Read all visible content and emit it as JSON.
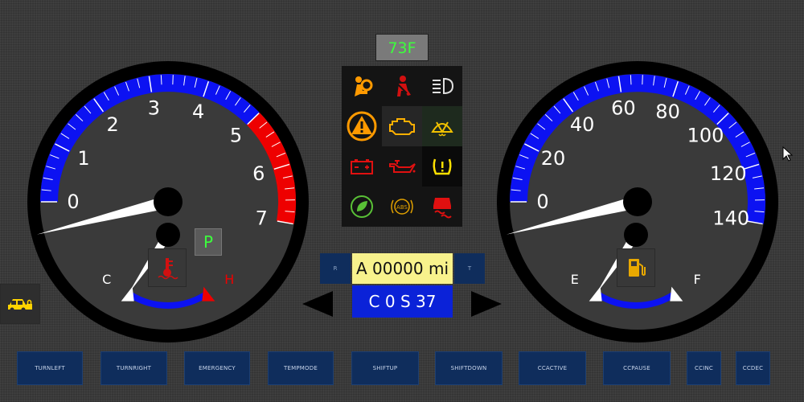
{
  "dashboard": {
    "outside_temp": "73F",
    "gear": "P",
    "odometer": "A 00000 mi",
    "cruise": "C 0  S 37",
    "odo_left_button": "R",
    "odo_right_button": "T"
  },
  "tachometer": {
    "labels": [
      "0",
      "1",
      "2",
      "3",
      "4",
      "5",
      "6",
      "7"
    ],
    "reading": 0,
    "colors": {
      "normal": "#0c12f2",
      "redline": "#ee0000"
    }
  },
  "speedometer": {
    "labels": [
      "0",
      "20",
      "40",
      "60",
      "80",
      "100",
      "120",
      "140"
    ],
    "reading": 0,
    "colors": {
      "band": "#0c12f2"
    }
  },
  "temp_gauge": {
    "cold_label": "C",
    "hot_label": "H",
    "icon": "coolant-temp-icon"
  },
  "fuel_gauge": {
    "empty_label": "E",
    "full_label": "F",
    "icon": "fuel-pump-icon"
  },
  "warning_lights": [
    {
      "icon": "airbag-icon",
      "color": "#ff9a00"
    },
    {
      "icon": "seatbelt-icon",
      "color": "#d21010"
    },
    {
      "icon": "headlight-icon",
      "color": "#e0e0e0"
    },
    {
      "icon": "master-warning-icon",
      "color": "#ff9a00"
    },
    {
      "icon": "check-engine-icon",
      "color": "#ffb000"
    },
    {
      "icon": "wiper-icon",
      "color": "#f0c000"
    },
    {
      "icon": "battery-icon",
      "color": "#e01010"
    },
    {
      "icon": "oil-pressure-icon",
      "color": "#e01010"
    },
    {
      "icon": "tire-pressure-icon",
      "color": "#ffe000"
    },
    {
      "icon": "eco-mode-icon",
      "color": "#59c036"
    },
    {
      "icon": "abs-icon",
      "color": "#e0a000"
    },
    {
      "icon": "traction-control-icon",
      "color": "#e01010"
    }
  ],
  "controls": [
    {
      "label": "TURNLEFT"
    },
    {
      "label": "TURNRIGHT"
    },
    {
      "label": "EMERGENCY"
    },
    {
      "label": "TEMPMODE"
    },
    {
      "label": "SHIFTUP"
    },
    {
      "label": "SHIFTDOWN"
    },
    {
      "label": "CCACTIVE"
    },
    {
      "label": "CCPAUSE"
    },
    {
      "label": "CCINC"
    },
    {
      "label": "CCDEC"
    }
  ]
}
